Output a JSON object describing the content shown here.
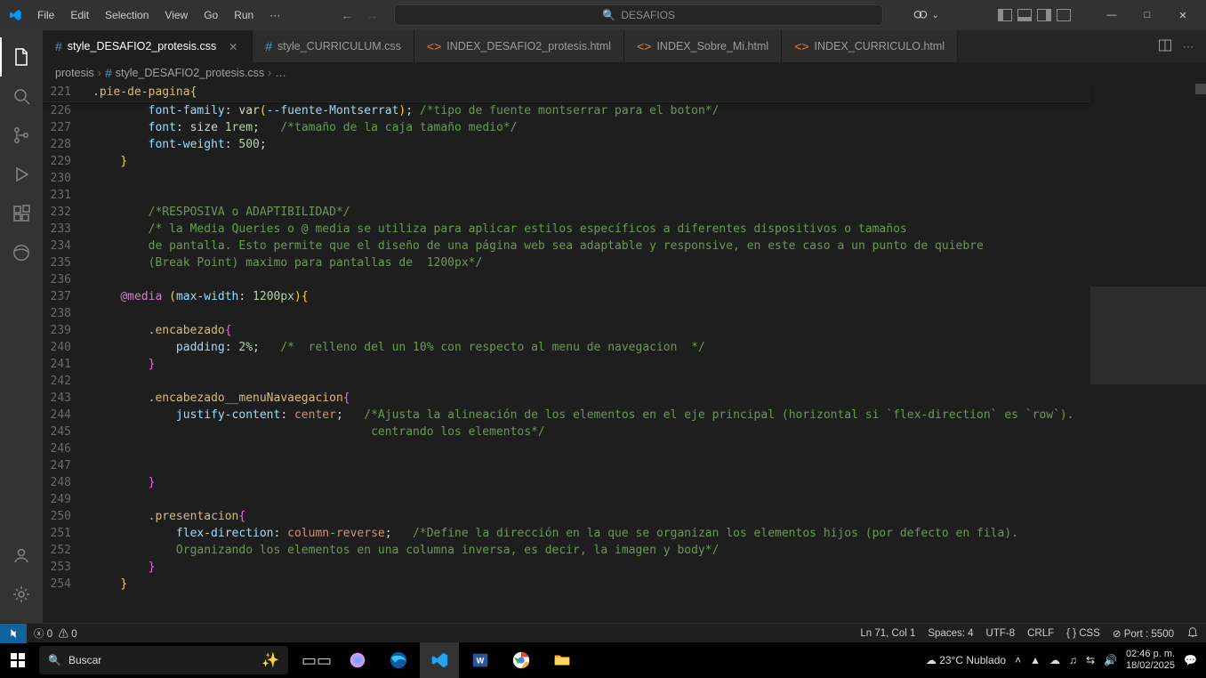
{
  "titlebar": {
    "menu": [
      "File",
      "Edit",
      "Selection",
      "View",
      "Go",
      "Run",
      "···"
    ],
    "search_placeholder": "DESAFIOS",
    "copilot_chev": "⌄"
  },
  "tabs": [
    {
      "icon": "css",
      "label": "style_DESAFIO2_protesis.css",
      "active": true,
      "close": true
    },
    {
      "icon": "css",
      "label": "style_CURRICULUM.css",
      "active": false,
      "close": false
    },
    {
      "icon": "html",
      "label": "INDEX_DESAFIO2_protesis.html",
      "active": false,
      "close": false
    },
    {
      "icon": "html",
      "label": "INDEX_Sobre_Mi.html",
      "active": false,
      "close": false
    },
    {
      "icon": "html",
      "label": "INDEX_CURRICULO.html",
      "active": false,
      "close": false
    }
  ],
  "breadcrumbs": {
    "root": "protesis",
    "file": "style_DESAFIO2_protesis.css",
    "more": "…"
  },
  "sticky_line": {
    "num": "221",
    "sel": ".pie-de-pagina",
    "brace": "{"
  },
  "code_lines": [
    {
      "n": "226",
      "seg": [
        {
          "t": "        ",
          "c": ""
        },
        {
          "t": "font-family",
          "c": "prop"
        },
        {
          "t": ": ",
          "c": "punc"
        },
        {
          "t": "var",
          "c": "func"
        },
        {
          "t": "(",
          "c": "brace"
        },
        {
          "t": "--fuente-Montserrat",
          "c": "var"
        },
        {
          "t": ")",
          "c": "brace"
        },
        {
          "t": "; ",
          "c": "punc"
        },
        {
          "t": "/*tipo de fuente montserrar para el boton*/",
          "c": "comm"
        }
      ]
    },
    {
      "n": "227",
      "seg": [
        {
          "t": "        ",
          "c": ""
        },
        {
          "t": "font",
          "c": "prop"
        },
        {
          "t": ": size ",
          "c": "punc"
        },
        {
          "t": "1rem",
          "c": "num"
        },
        {
          "t": ";   ",
          "c": "punc"
        },
        {
          "t": "/*tamaño de la caja tamaño medio*/",
          "c": "comm"
        }
      ]
    },
    {
      "n": "228",
      "seg": [
        {
          "t": "        ",
          "c": ""
        },
        {
          "t": "font-weight",
          "c": "prop"
        },
        {
          "t": ": ",
          "c": "punc"
        },
        {
          "t": "500",
          "c": "num"
        },
        {
          "t": ";",
          "c": "punc"
        }
      ]
    },
    {
      "n": "229",
      "seg": [
        {
          "t": "    ",
          "c": ""
        },
        {
          "t": "}",
          "c": "brace"
        }
      ]
    },
    {
      "n": "230",
      "seg": []
    },
    {
      "n": "231",
      "seg": []
    },
    {
      "n": "232",
      "seg": [
        {
          "t": "        ",
          "c": ""
        },
        {
          "t": "/*RESPOSIVA o ADAPTIBILIDAD*/",
          "c": "comm"
        }
      ]
    },
    {
      "n": "233",
      "seg": [
        {
          "t": "        ",
          "c": ""
        },
        {
          "t": "/* la Media Queries o @ media se utiliza para aplicar estilos específicos a diferentes dispositivos o tamaños",
          "c": "comm"
        }
      ]
    },
    {
      "n": "234",
      "seg": [
        {
          "t": "        ",
          "c": ""
        },
        {
          "t": "de pantalla. Esto permite que el diseño de una página web sea adaptable y responsive, en este caso a un punto de quiebre",
          "c": "comm"
        }
      ]
    },
    {
      "n": "235",
      "seg": [
        {
          "t": "        ",
          "c": ""
        },
        {
          "t": "(Break Point) maximo para pantallas de  1200px*/",
          "c": "comm"
        }
      ]
    },
    {
      "n": "236",
      "seg": []
    },
    {
      "n": "237",
      "seg": [
        {
          "t": "    ",
          "c": ""
        },
        {
          "t": "@media",
          "c": "media"
        },
        {
          "t": " ",
          "c": ""
        },
        {
          "t": "(",
          "c": "brace"
        },
        {
          "t": "max-width",
          "c": "prop"
        },
        {
          "t": ": ",
          "c": "punc"
        },
        {
          "t": "1200px",
          "c": "num"
        },
        {
          "t": ")",
          "c": "brace"
        },
        {
          "t": "{",
          "c": "brace"
        }
      ]
    },
    {
      "n": "238",
      "seg": []
    },
    {
      "n": "239",
      "seg": [
        {
          "t": "        ",
          "c": ""
        },
        {
          "t": ".encabezado",
          "c": "sel"
        },
        {
          "t": "{",
          "c": "brace2"
        }
      ]
    },
    {
      "n": "240",
      "seg": [
        {
          "t": "            ",
          "c": ""
        },
        {
          "t": "padding",
          "c": "prop"
        },
        {
          "t": ": ",
          "c": "punc"
        },
        {
          "t": "2%",
          "c": "num"
        },
        {
          "t": ";   ",
          "c": "punc"
        },
        {
          "t": "/*  relleno del un 10% con respecto al menu de navegacion  */",
          "c": "comm"
        }
      ]
    },
    {
      "n": "241",
      "seg": [
        {
          "t": "        ",
          "c": ""
        },
        {
          "t": "}",
          "c": "brace2"
        }
      ]
    },
    {
      "n": "242",
      "seg": []
    },
    {
      "n": "243",
      "seg": [
        {
          "t": "        ",
          "c": ""
        },
        {
          "t": ".encabezado__menuNavaegacion",
          "c": "sel"
        },
        {
          "t": "{",
          "c": "brace2"
        }
      ]
    },
    {
      "n": "244",
      "seg": [
        {
          "t": "            ",
          "c": ""
        },
        {
          "t": "justify-content",
          "c": "prop"
        },
        {
          "t": ": ",
          "c": "punc"
        },
        {
          "t": "center",
          "c": "val"
        },
        {
          "t": ";   ",
          "c": "punc"
        },
        {
          "t": "/*Ajusta la alineación de los elementos en el eje principal (horizontal si `flex-direction` es `row`).",
          "c": "comm"
        }
      ]
    },
    {
      "n": "245",
      "seg": [
        {
          "t": "                                        ",
          "c": ""
        },
        {
          "t": "centrando los elementos*/",
          "c": "comm"
        }
      ]
    },
    {
      "n": "246",
      "seg": []
    },
    {
      "n": "247",
      "seg": []
    },
    {
      "n": "248",
      "seg": [
        {
          "t": "        ",
          "c": ""
        },
        {
          "t": "}",
          "c": "brace2"
        }
      ]
    },
    {
      "n": "249",
      "seg": []
    },
    {
      "n": "250",
      "seg": [
        {
          "t": "        ",
          "c": ""
        },
        {
          "t": ".presentacion",
          "c": "sel"
        },
        {
          "t": "{",
          "c": "brace2"
        }
      ]
    },
    {
      "n": "251",
      "seg": [
        {
          "t": "            ",
          "c": ""
        },
        {
          "t": "flex-direction",
          "c": "prop"
        },
        {
          "t": ": ",
          "c": "punc"
        },
        {
          "t": "column-reverse",
          "c": "val"
        },
        {
          "t": ";   ",
          "c": "punc"
        },
        {
          "t": "/*Define la dirección en la que se organizan los elementos hijos (por defecto en fila).",
          "c": "comm"
        }
      ]
    },
    {
      "n": "252",
      "seg": [
        {
          "t": "            ",
          "c": ""
        },
        {
          "t": "Organizando los elementos en una columna inversa, es decir, la imagen y body*/",
          "c": "comm"
        }
      ]
    },
    {
      "n": "253",
      "seg": [
        {
          "t": "        ",
          "c": ""
        },
        {
          "t": "}",
          "c": "brace2"
        }
      ]
    },
    {
      "n": "254",
      "seg": [
        {
          "t": "    ",
          "c": ""
        },
        {
          "t": "}",
          "c": "brace"
        }
      ]
    }
  ],
  "statusbar": {
    "errors": "0",
    "warnings": "0",
    "ln_col": "Ln 71, Col 1",
    "spaces": "Spaces: 4",
    "encoding": "UTF-8",
    "eol": "CRLF",
    "lang": "CSS",
    "port": "Port : 5500",
    "port_icon": "⊘"
  },
  "taskbar": {
    "search_placeholder": "Buscar",
    "weather": "23°C  Nublado",
    "time": "02:46 p. m.",
    "date": "18/02/2025"
  }
}
